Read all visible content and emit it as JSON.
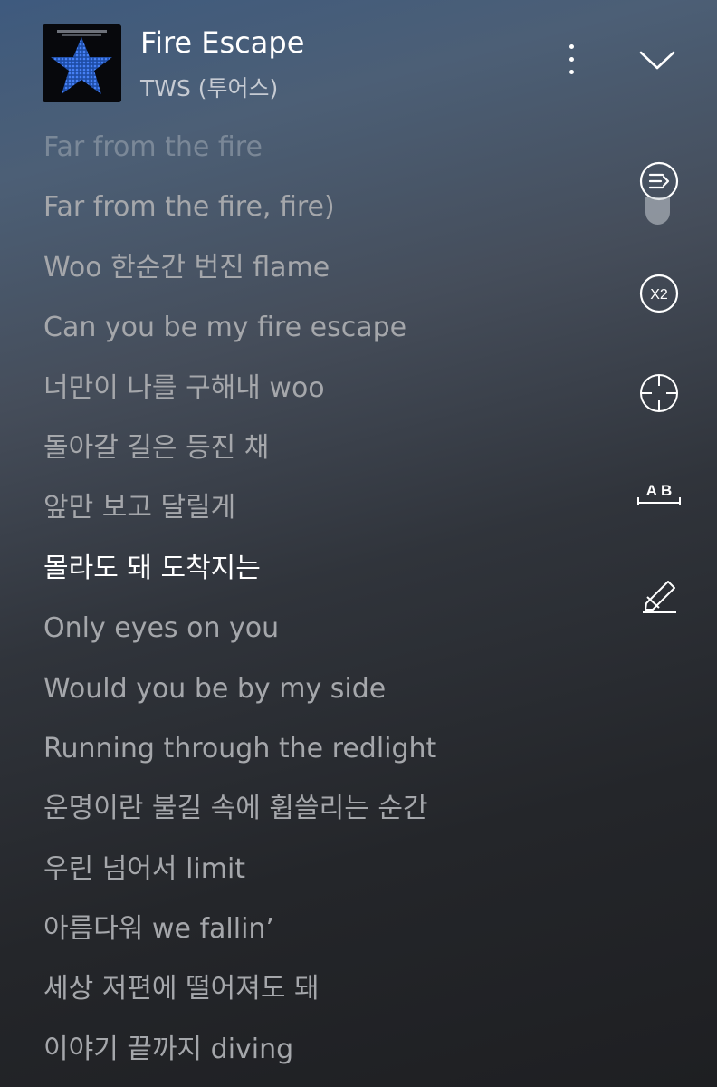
{
  "song": {
    "title": "Fire Escape",
    "artist": "TWS (투어스)"
  },
  "lyrics": [
    {
      "text": "Far from the fire",
      "state": "faded"
    },
    {
      "text": "Far from the fire, fire)",
      "state": "normal"
    },
    {
      "text": "Woo 한순간 번진 flame",
      "state": "normal"
    },
    {
      "text": "Can you be my fire escape",
      "state": "normal"
    },
    {
      "text": "너만이 나를 구해내 woo",
      "state": "normal"
    },
    {
      "text": "돌아갈 길은 등진 채",
      "state": "normal"
    },
    {
      "text": "앞만 보고 달릴게",
      "state": "normal"
    },
    {
      "text": "몰라도 돼 도착지는",
      "state": "current"
    },
    {
      "text": "Only eyes on you",
      "state": "normal"
    },
    {
      "text": "Would you be by my side",
      "state": "normal"
    },
    {
      "text": "Running through the redlight",
      "state": "normal"
    },
    {
      "text": "운명이란 불길 속에 휩쓸리는 순간",
      "state": "normal"
    },
    {
      "text": "우린 넘어서 limit",
      "state": "normal"
    },
    {
      "text": "아름다워 we fallin’",
      "state": "normal"
    },
    {
      "text": "세상 저편에 떨어져도 돼",
      "state": "normal"
    },
    {
      "text": "이야기 끝까지 diving",
      "state": "normal"
    }
  ],
  "tools": {
    "speed_label": "X2",
    "ab_label": "A B"
  },
  "icons": {
    "more": "more-vertical-icon",
    "collapse": "chevron-down-icon",
    "autoscroll": "lyrics-autoscroll-icon",
    "speed": "playback-speed-icon",
    "locate": "crosshair-icon",
    "ab_repeat": "ab-repeat-icon",
    "highlight": "highlighter-icon"
  },
  "colors": {
    "current_line": "#ffffff",
    "lyric_line": "#a5a7ab",
    "album_star": "#2f63c9"
  }
}
